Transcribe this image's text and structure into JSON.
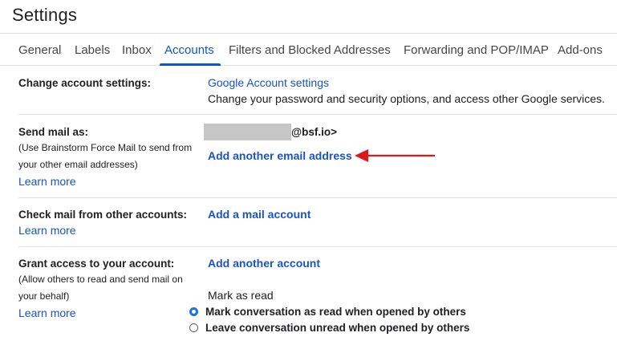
{
  "page_title": "Settings",
  "tabs": [
    {
      "label": "General"
    },
    {
      "label": "Labels"
    },
    {
      "label": "Inbox"
    },
    {
      "label": "Accounts",
      "active": true
    },
    {
      "label": "Filters and Blocked Addresses"
    },
    {
      "label": "Forwarding and POP/IMAP"
    },
    {
      "label": "Add-ons"
    }
  ],
  "change_account": {
    "label": "Change account settings:",
    "link": "Google Account settings",
    "description": "Change your password and security options, and access other Google services."
  },
  "send_mail_as": {
    "label": "Send mail as:",
    "sub_line1": "(Use Brainstorm Force Mail to send from",
    "sub_line2": "your other email addresses)",
    "learn_more": "Learn more",
    "email_suffix": "@bsf.io>",
    "add_link": "Add another email address"
  },
  "check_mail": {
    "label": "Check mail from other accounts:",
    "learn_more": "Learn more",
    "add_link": "Add a mail account"
  },
  "grant_access": {
    "label": "Grant access to your account:",
    "sub_line1": "(Allow others to read and send mail on",
    "sub_line2": "your behalf)",
    "learn_more": "Learn more",
    "add_link": "Add another account",
    "mark_as_read_heading": "Mark as read",
    "options": [
      {
        "label": "Mark conversation as read when opened by others",
        "checked": true
      },
      {
        "label": "Leave conversation unread when opened by others",
        "checked": false
      }
    ]
  },
  "colors": {
    "accent": "#0b57d0",
    "link": "#1a53c6",
    "annotation_arrow": "#e0161b",
    "redaction": "#c6c6c6"
  }
}
